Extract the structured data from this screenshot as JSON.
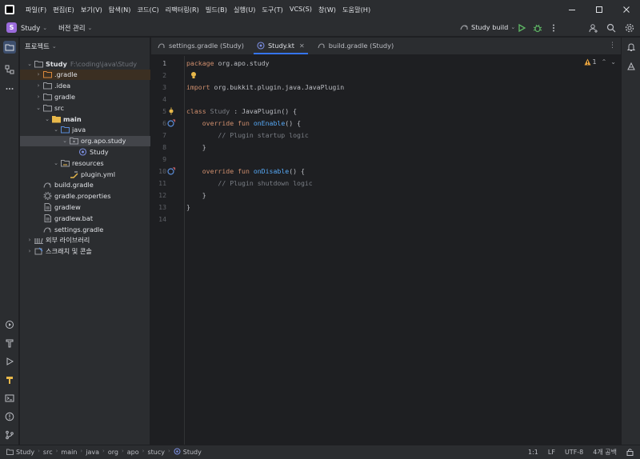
{
  "titlebar": {
    "menus": [
      "파일(F)",
      "편집(E)",
      "보기(V)",
      "탐색(N)",
      "코드(C)",
      "리팩터링(R)",
      "빌드(B)",
      "실행(U)",
      "도구(T)",
      "VCS(S)",
      "창(W)",
      "도움말(H)"
    ]
  },
  "toolbar": {
    "project_badge": "S",
    "project_name": "Study",
    "vcs_label": "버전 관리",
    "run_config": "Study build"
  },
  "project_panel": {
    "title": "프로젝트",
    "tree": [
      {
        "label": "Study",
        "path": "F:\\coding\\java\\Study",
        "depth": 0,
        "chevron": "down",
        "icon": "folder-icon",
        "bold": true
      },
      {
        "label": ".gradle",
        "depth": 1,
        "chevron": "right",
        "icon": "folder-orange-icon",
        "highlight": true
      },
      {
        "label": ".idea",
        "depth": 1,
        "chevron": "right",
        "icon": "folder-icon"
      },
      {
        "label": "gradle",
        "depth": 1,
        "chevron": "right",
        "icon": "folder-icon"
      },
      {
        "label": "src",
        "depth": 1,
        "chevron": "down",
        "icon": "folder-icon"
      },
      {
        "label": "main",
        "depth": 2,
        "chevron": "down",
        "icon": "module-icon",
        "bold": true
      },
      {
        "label": "java",
        "depth": 3,
        "chevron": "down",
        "icon": "source-folder-icon"
      },
      {
        "label": "org.apo.study",
        "depth": 4,
        "chevron": "down",
        "icon": "package-icon",
        "selected": true
      },
      {
        "label": "Study",
        "depth": 5,
        "chevron": "",
        "icon": "kotlin-class-icon"
      },
      {
        "label": "resources",
        "depth": 3,
        "chevron": "down",
        "icon": "resources-folder-icon"
      },
      {
        "label": "plugin.yml",
        "depth": 4,
        "chevron": "",
        "icon": "yaml-file-icon"
      },
      {
        "label": "build.gradle",
        "depth": 1,
        "chevron": "",
        "icon": "gradle-file-icon"
      },
      {
        "label": "gradle.properties",
        "depth": 1,
        "chevron": "",
        "icon": "properties-file-icon"
      },
      {
        "label": "gradlew",
        "depth": 1,
        "chevron": "",
        "icon": "file-icon"
      },
      {
        "label": "gradlew.bat",
        "depth": 1,
        "chevron": "",
        "icon": "file-icon"
      },
      {
        "label": "settings.gradle",
        "depth": 1,
        "chevron": "",
        "icon": "gradle-file-icon"
      },
      {
        "label": "외부 라이브러리",
        "depth": 0,
        "chevron": "right",
        "icon": "library-icon"
      },
      {
        "label": "스크래치 및 콘솔",
        "depth": 0,
        "chevron": "right",
        "icon": "scratch-icon"
      }
    ]
  },
  "editor": {
    "tabs": [
      {
        "label": "settings.gradle (Study)",
        "icon": "gradle-file-icon",
        "active": false
      },
      {
        "label": "Study.kt",
        "icon": "kotlin-class-icon",
        "active": true
      },
      {
        "label": "build.gradle (Study)",
        "icon": "gradle-file-icon",
        "active": false
      }
    ],
    "inspection_count": "1",
    "line_numbers": [
      "1",
      "2",
      "3",
      "4",
      "5",
      "6",
      "7",
      "8",
      "9",
      "10",
      "11",
      "12",
      "13",
      "14"
    ],
    "lines": [
      "package org.apo.study",
      "",
      "import org.bukkit.plugin.java.JavaPlugin",
      "",
      "class Study : JavaPlugin() {",
      "    override fun onEnable() {",
      "        // Plugin startup logic",
      "    }",
      "",
      "    override fun onDisable() {",
      "        // Plugin shutdown logic",
      "    }",
      "}",
      ""
    ]
  },
  "statusbar": {
    "breadcrumbs": [
      "Study",
      "src",
      "main",
      "java",
      "org",
      "apo",
      "stucy",
      "Study"
    ],
    "position": "1:1",
    "line_sep": "LF",
    "encoding": "UTF-8",
    "indent": "4개 공백"
  },
  "colors": {
    "accent": "#3574f0",
    "background": "#1e1f22",
    "panel": "#2b2d30",
    "keyword": "#cf8e6d",
    "function": "#56a8f5",
    "comment": "#7a7e85"
  }
}
